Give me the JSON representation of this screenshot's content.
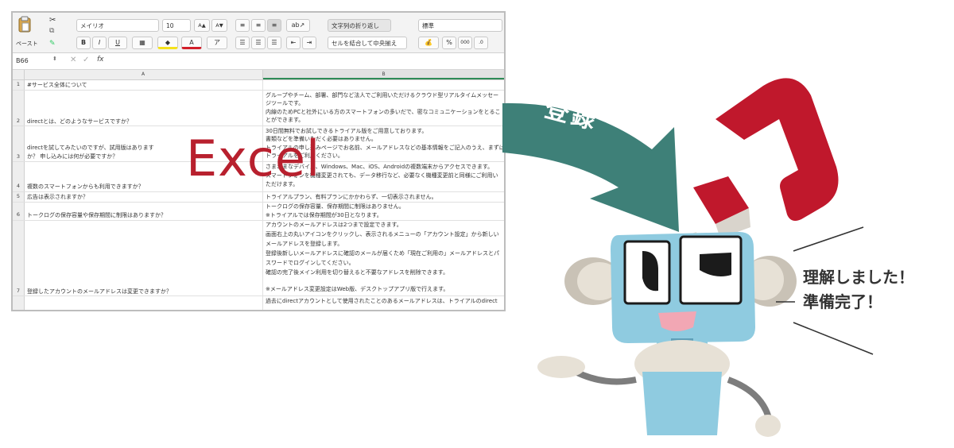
{
  "excel_window": {
    "ribbon": {
      "paste_label": "ペースト",
      "font_name": "メイリオ",
      "font_size": "10",
      "grow_font": "A▲",
      "shrink_font": "A▼",
      "bold": "B",
      "italic": "I",
      "underline": "U",
      "wrap_text_label": "文字列の折り返し",
      "merge_center_label": "セルを結合して中央揃え",
      "number_format": "標準",
      "percent": "%"
    },
    "name_box": "B66",
    "fx": "fx",
    "columns": [
      "A",
      "B"
    ],
    "rows": [
      {
        "num": "1",
        "a": "#サービス全体について",
        "b": []
      },
      {
        "num": "2",
        "a": "directとは、どのようなサービスですか？",
        "b": [
          "グループやチーム、部署、部門など法人でご利用いただけるクラウド型リアルタイムメッセー",
          "ジツールです。",
          "内線のためPCと社外にいる方のスマートフォンの多いだで、密なコミュニケーションをとるこ",
          "とができます。"
        ]
      },
      {
        "num": "3",
        "a": "directを試してみたいのですが、試用版はありますか？ 申し込みには何が必要ですか？",
        "b": [
          "30日間無料でお試しできるトライアル版をご用意しております。",
          "書類などを準備いただく必要はありません。",
          "トライアルの申し込みページでお名前、メールアドレスなどの基本情報をご記入のうえ、まずは",
          "トライアルをご利用ください。"
        ]
      },
      {
        "num": "4",
        "a": "複数のスマートフォンからも利用できますか？",
        "b": [
          "さまざまなデバイス、Windows、Mac、iOS、Androidの複数端末からアクセスできます。",
          "スマートフォンを機種変更されても、データ移行など、必要なく機種変更前と同様にご利用い",
          "ただけます。"
        ]
      },
      {
        "num": "5",
        "a": "広告は表示されますか？",
        "b": [
          "トライアルプラン、有料プランにかかわらず、一切表示されません。"
        ]
      },
      {
        "num": "6",
        "a": "トークログの保存容量や保存期間に制限はありますか？",
        "b": [
          "トークログの保存容量、保存期間に制限はありません。",
          "※トライアルでは保存期間が30日となります。"
        ]
      },
      {
        "num": "7",
        "a": "登録したアカウントのメールアドレスは変更できますか？",
        "b": [
          "アカウントのメールアドレスは2つまで設定できます。",
          "画面右上の丸いアイコンをクリックし、表示されるメニューの「アカウント設定」から新しい",
          "メールアドレスを登録します。",
          "登録後新しいメールアドレスに確認のメールが届くため「現在ご利用の」メールアドレスとパ",
          "スワードでログインしてください。",
          "確認の完了後メイン利用を切り替えると不要なアドレスを削除できます。",
          "",
          "※メールアドレス変更設定はWeb版、デスクトップアプリ版で行えます。"
        ]
      },
      {
        "num": "",
        "a": "",
        "b": [
          "過去にdirectアカウントとして使用されたことのあるメールアドレスは、トライアルのdirect"
        ]
      }
    ]
  },
  "excel_label": "Excel",
  "arrow_label": "登録",
  "speech": {
    "line1": "理解しました！",
    "line2": "準備完了！"
  },
  "colors": {
    "excel_red": "#b8202e",
    "arrow_teal": "#3e8078",
    "robot_blue": "#8fcbe0",
    "phone_red": "#c0182c"
  },
  "icons": [
    "paste-icon",
    "scissors-icon",
    "copy-icon",
    "format-painter-icon",
    "phone-icon",
    "robot-icon",
    "sparkle-icon"
  ]
}
